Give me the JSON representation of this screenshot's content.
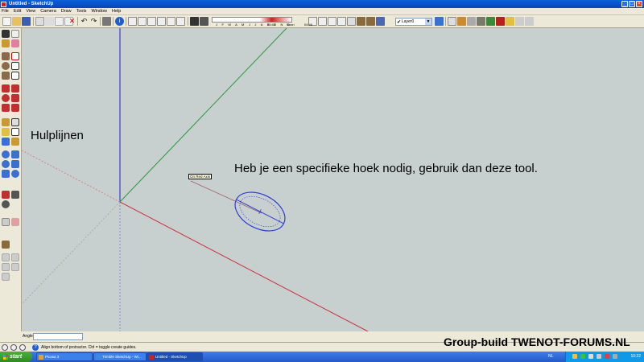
{
  "window": {
    "title": "Untitled - SketchUp"
  },
  "menu": [
    "File",
    "Edit",
    "View",
    "Camera",
    "Draw",
    "Tools",
    "Window",
    "Help"
  ],
  "shadow": {
    "months": "J F M A M J J A S O N D",
    "time_left": "06:43",
    "time_mid": "Noon",
    "time_right": "04:46"
  },
  "layer": {
    "selected": "Layer0"
  },
  "viewport": {
    "tooltip": "On Red Axis",
    "annotation_left": "Hulplijnen",
    "annotation_main": "Heb je een specifieke hoek nodig, gebruik dan deze tool."
  },
  "measurement": {
    "label": "Angle",
    "value": ""
  },
  "status": {
    "text": "Align bottom of protractor.  Ctrl = toggle create guides."
  },
  "brand": "Group-build TWENOT-FORUMS.NL",
  "taskbar": {
    "start": "start",
    "tasks": [
      "Picasa 3",
      "Trimble SketchUp - Wi...",
      "Untitled - SketchUp"
    ],
    "lang": "NL",
    "clock": "10:22"
  },
  "colors": {
    "red_axis": "#c8323c",
    "green_axis": "#2a9d3a",
    "blue_axis": "#2020c8",
    "protractor": "#2b3fd6"
  }
}
